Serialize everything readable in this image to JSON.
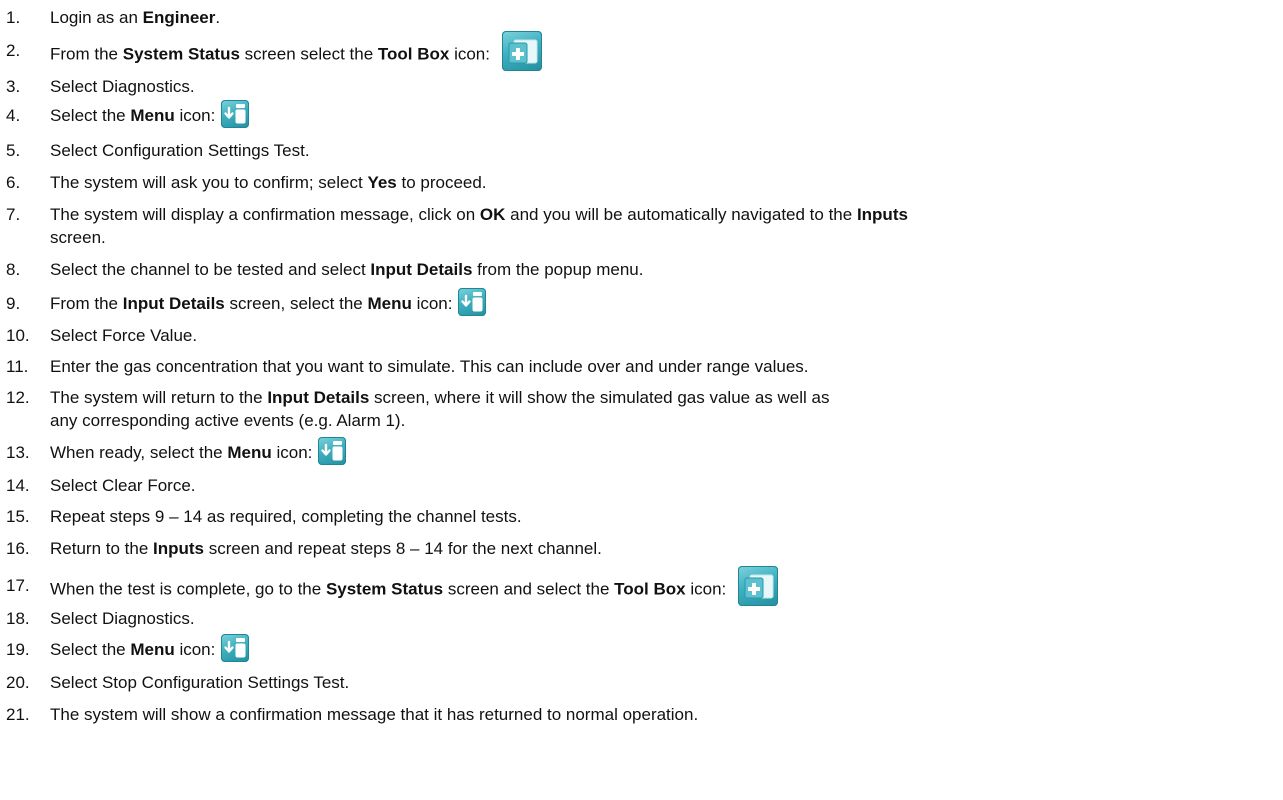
{
  "steps": [
    {
      "num": "1.",
      "pre": "Login as an ",
      "b1": "Engineer",
      "post": "."
    },
    {
      "num": "2.",
      "pre": "From the ",
      "b1": "System Status",
      "mid": " screen select the ",
      "b2": "Tool Box",
      "post": " icon:",
      "icon": "toolbox-icon"
    },
    {
      "num": "3.",
      "pre": "Select Diagnostics."
    },
    {
      "num": "4.",
      "pre": "Select the ",
      "b1": "Menu",
      "post": " icon:",
      "icon": "menu-icon"
    },
    {
      "num": "5.",
      "pre": "Select Configuration Settings Test."
    },
    {
      "num": "6.",
      "pre": "The system will ask you to confirm; select ",
      "b1": "Yes",
      "post": " to proceed."
    },
    {
      "num": "7.",
      "pre": "The system will display a confirmation message, click on ",
      "b1": "OK",
      "mid": " and you will be automatically navigated to the ",
      "b2": "Inputs",
      "cont": "screen."
    },
    {
      "num": "8.",
      "pre": "Select the channel to be tested and select ",
      "b1": "Input Details",
      "post": " from the popup menu."
    },
    {
      "num": "9.",
      "pre": "From the ",
      "b1": "Input Details",
      "mid": " screen, select the ",
      "b2": "Menu",
      "post": " icon:",
      "icon": "menu-icon"
    },
    {
      "num": "10.",
      "pre": "Select Force Value."
    },
    {
      "num": "11.",
      "pre": "Enter the gas concentration that you want to simulate. This can include over and under range values."
    },
    {
      "num": "12.",
      "pre": "The system will return to the ",
      "b1": "Input Details",
      "post": " screen, where it will show the simulated gas value as well as",
      "cont": "any corresponding active events (e.g. Alarm 1)."
    },
    {
      "num": "13.",
      "pre": "When ready, select the ",
      "b1": "Menu",
      "post": " icon:",
      "icon": "menu-icon"
    },
    {
      "num": "14.",
      "pre": "Select Clear Force."
    },
    {
      "num": "15.",
      "pre": "Repeat steps 9 – 14 as required, completing the channel tests."
    },
    {
      "num": "16.",
      "pre": "Return to the ",
      "b1": "Inputs",
      "post": " screen and repeat steps 8 – 14 for the next channel."
    },
    {
      "num": "17.",
      "pre": "When the test is complete, go to the ",
      "b1": "System Status",
      "mid": " screen and select the ",
      "b2": "Tool Box",
      "post": " icon:",
      "icon": "toolbox-icon"
    },
    {
      "num": "18.",
      "pre": "Select Diagnostics."
    },
    {
      "num": "19.",
      "pre": "Select the ",
      "b1": "Menu",
      "post": " icon:",
      "icon": "menu-icon"
    },
    {
      "num": "20.",
      "pre": "Select Stop Configuration Settings Test."
    },
    {
      "num": "21.",
      "pre": "The system will show a confirmation message that it has returned to normal operation."
    }
  ],
  "icon_colors": {
    "tile": "#3fb0c0",
    "symbol": "#ffffff"
  }
}
